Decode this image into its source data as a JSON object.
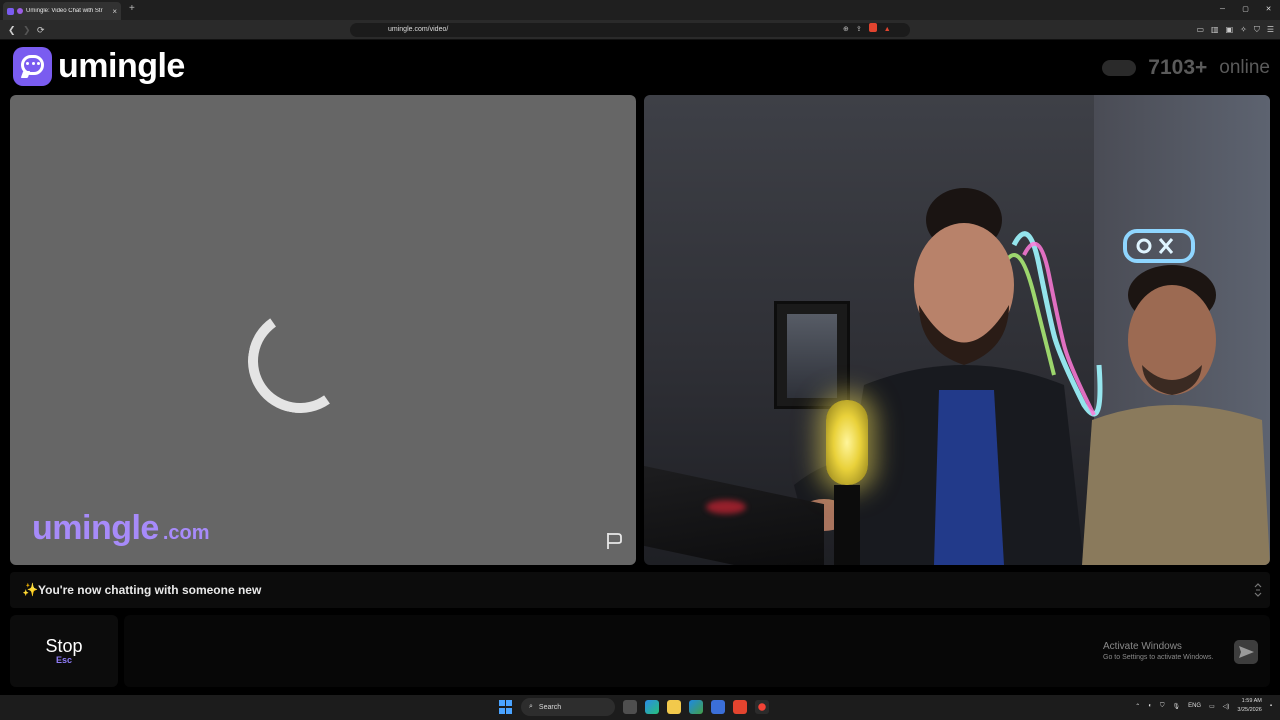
{
  "browser": {
    "tab_title": "Umingle: Video Chat with Str",
    "tab_close": "×",
    "new_tab": "+",
    "url": "umingle.com/video/",
    "window_controls": [
      "─",
      "▢",
      "✕"
    ]
  },
  "header": {
    "logo_text": "umingle",
    "online_count": "7103+",
    "online_label": "online"
  },
  "stranger_video": {
    "watermark_main": "umingle",
    "watermark_suffix": ".com"
  },
  "status": {
    "icon": "✨",
    "message": "You're now chatting with someone new"
  },
  "controls": {
    "stop_label": "Stop",
    "stop_key": "Esc"
  },
  "system_overlay": {
    "activate_title": "Activate Windows",
    "activate_subtitle": "Go to Settings to activate Windows."
  },
  "taskbar": {
    "search_label": "Search",
    "language": "ENG",
    "time": "1:59 AM",
    "date": "3/25/2026"
  },
  "colors": {
    "brand": "#7a5cf0",
    "watermark": "#a78bfa",
    "accent_key": "#8f7cf7"
  }
}
